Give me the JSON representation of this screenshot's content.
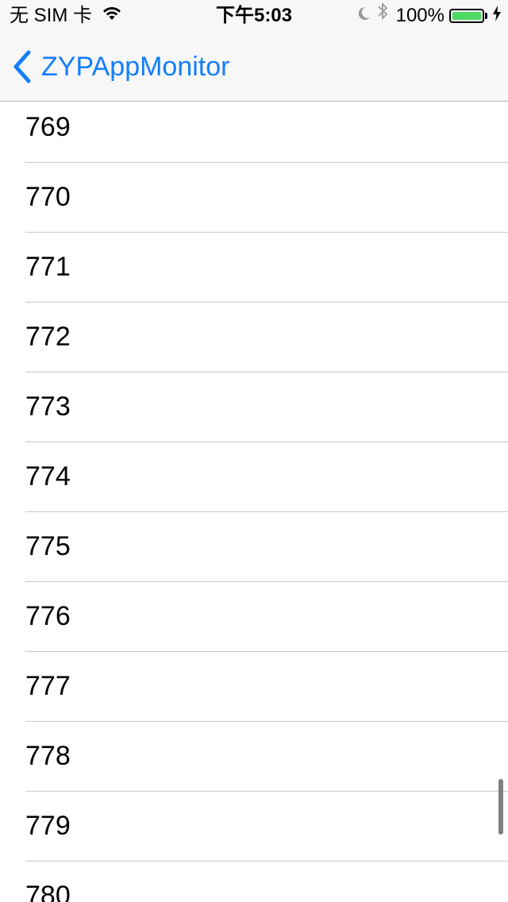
{
  "status_bar": {
    "carrier": "无 SIM 卡",
    "time": "下午5:03",
    "battery_percent": "100%",
    "battery_level": 1.0,
    "wifi_icon": "wifi-icon",
    "moon_icon": "do-not-disturb-moon-icon",
    "bluetooth_icon": "bluetooth-icon",
    "charging_icon": "charging-bolt-icon"
  },
  "nav_bar": {
    "back_label": "ZYPAppMonitor",
    "back_icon": "chevron-left-icon",
    "accent_color": "#147efb"
  },
  "table": {
    "rows": [
      "769",
      "770",
      "771",
      "772",
      "773",
      "774",
      "775",
      "776",
      "777",
      "778",
      "779",
      "780"
    ]
  },
  "colors": {
    "battery_fill": "#4cd964",
    "separator": "#c8c7cc",
    "bar_background": "#f7f7f7"
  }
}
